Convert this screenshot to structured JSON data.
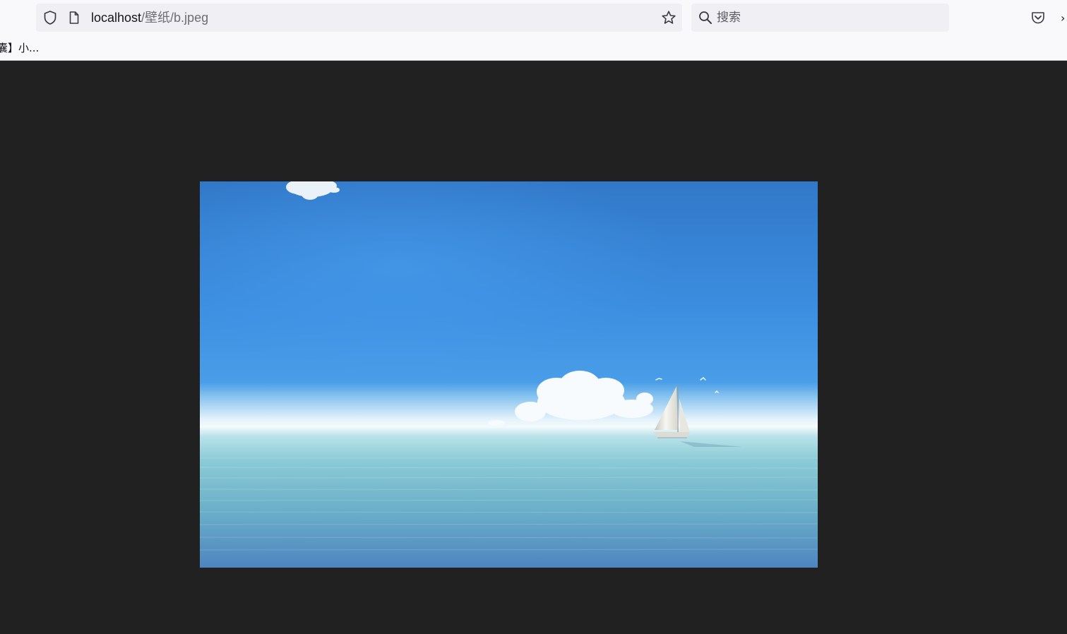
{
  "toolbar": {
    "url_host": "localhost",
    "url_path": "/壁纸/b.jpeg",
    "search_placeholder": "搜索",
    "overflow_glyph": "›"
  },
  "bookmarks": {
    "items": [
      {
        "label": "囊】小..."
      }
    ]
  },
  "icons": {
    "shield": "shield-icon",
    "page": "page-icon",
    "star": "star-icon",
    "search": "search-icon",
    "pocket": "pocket-icon"
  },
  "colors": {
    "chrome_bg": "#f9f9fb",
    "field_bg": "#f0f0f4",
    "viewer_bg": "#212121",
    "sky": "#3d8fe6",
    "sea": "#6fb0c8"
  }
}
